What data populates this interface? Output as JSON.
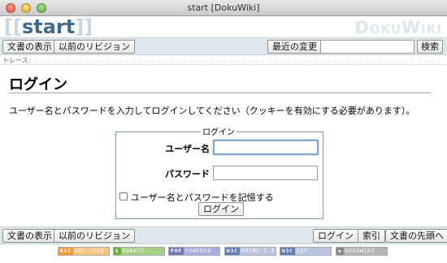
{
  "window": {
    "title": "start [DokuWiki]"
  },
  "header": {
    "logo_open": "[[",
    "logo_text": "start",
    "logo_close": "]]",
    "brand": "DokuWiki"
  },
  "toolbar_top": {
    "show_page": "文書の表示",
    "old_revisions": "以前のリビジョン",
    "recent_changes": "最近の変更",
    "search_value": "",
    "search_button": "検索"
  },
  "breadcrumb": {
    "label": "トレース:"
  },
  "main": {
    "title": "ログイン",
    "intro": "ユーザー名とパスワードを入力してログインしてください（クッキーを有効にする必要があります）。",
    "form": {
      "legend": "ログイン",
      "username_label": "ユーザー名",
      "username_value": "",
      "password_label": "パスワード",
      "password_value": "",
      "remember_label": "ユーザー名とパスワードを記憶する",
      "remember_checked": false,
      "submit": "ログイン"
    }
  },
  "toolbar_bottom": {
    "show_page": "文書の表示",
    "old_revisions": "以前のリビジョン",
    "login": "ログイン",
    "index": "索引",
    "top": "文書の先頭へ"
  },
  "footer_badges": [
    {
      "left": "RSS",
      "right": "XML FEED",
      "left_color": "#f39a3b",
      "right_color": "#f8c27f"
    },
    {
      "left": "$",
      "right": "DONATE",
      "left_color": "#6cae3b",
      "right_color": "#a4cf84"
    },
    {
      "left": "PHP",
      "right": "POWERED",
      "left_color": "#7078b8",
      "right_color": "#a8aedb"
    },
    {
      "left": "W3C",
      "right": "XHTML 1.0",
      "left_color": "#5f7fb0",
      "right_color": "#b9c6de"
    },
    {
      "left": "W3C",
      "right": "CSS",
      "left_color": "#5f7fb0",
      "right_color": "#b9c6de"
    },
    {
      "left": "◆",
      "right": "DOKUWIKI",
      "left_color": "#8a8a8a",
      "right_color": "#b6b6b6"
    }
  ]
}
